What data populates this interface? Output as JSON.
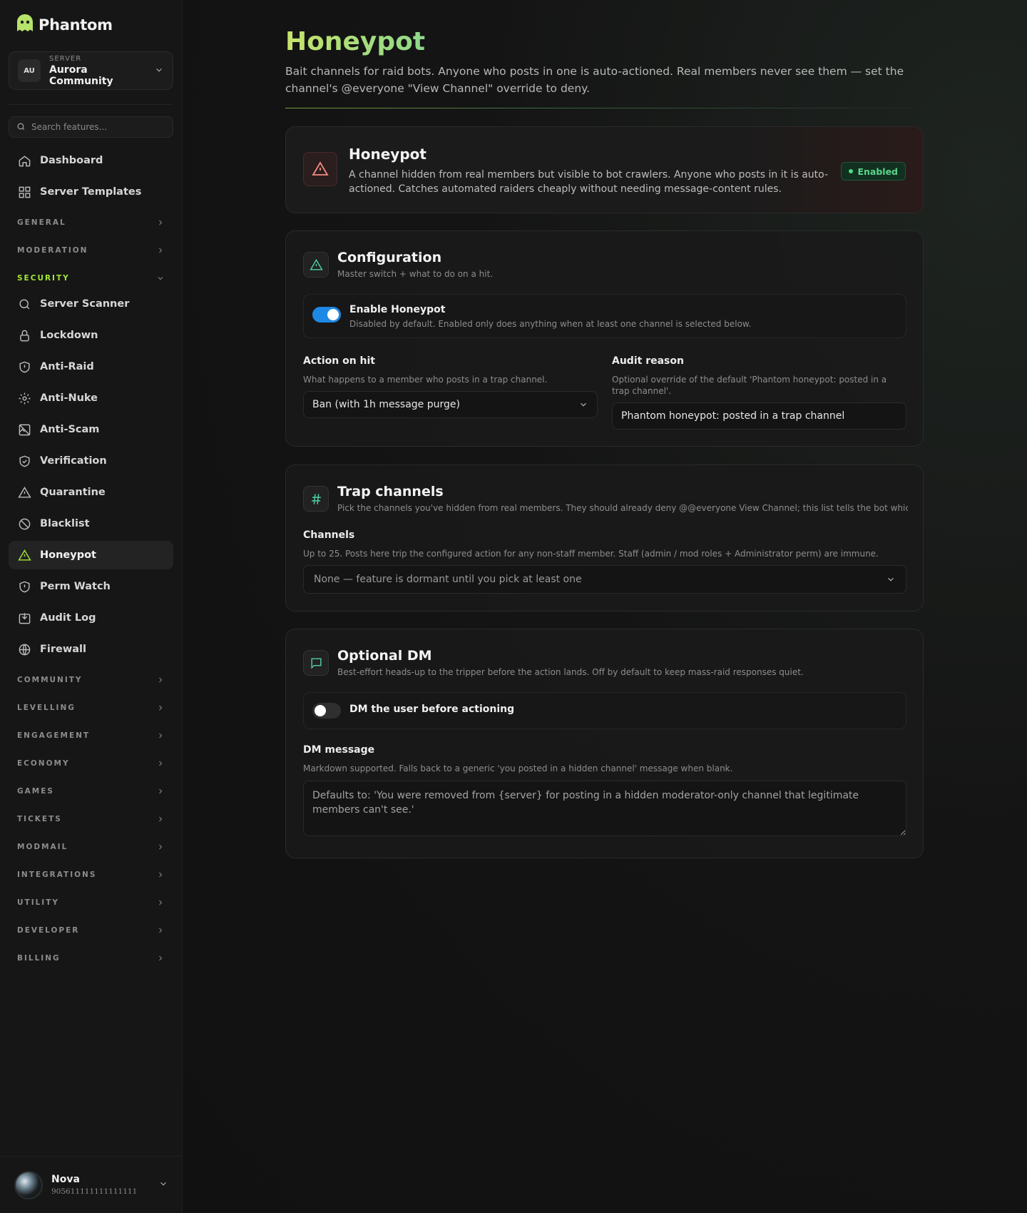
{
  "brand": {
    "name": "Phantom"
  },
  "server": {
    "caption": "SERVER",
    "name": "Aurora Community",
    "initials": "AU"
  },
  "search": {
    "placeholder": "Search features..."
  },
  "nav_top": [
    {
      "label": "Dashboard",
      "icon": "home-icon"
    },
    {
      "label": "Server Templates",
      "icon": "grid-icon"
    }
  ],
  "sections": {
    "general": "GENERAL",
    "moderation": "MODERATION",
    "security": "SECURITY",
    "community": "COMMUNITY",
    "levelling": "LEVELLING",
    "engagement": "ENGAGEMENT",
    "economy": "ECONOMY",
    "games": "GAMES",
    "tickets": "TICKETS",
    "modmail": "MODMAIL",
    "integrations": "INTEGRATIONS",
    "utility": "UTILITY",
    "developer": "DEVELOPER",
    "billing": "BILLING"
  },
  "security_items": [
    {
      "label": "Server Scanner",
      "icon": "search-icon"
    },
    {
      "label": "Lockdown",
      "icon": "lock-icon"
    },
    {
      "label": "Anti-Raid",
      "icon": "shield-alert-icon"
    },
    {
      "label": "Anti-Nuke",
      "icon": "gear-icon"
    },
    {
      "label": "Anti-Scam",
      "icon": "image-off-icon"
    },
    {
      "label": "Verification",
      "icon": "shield-check-icon"
    },
    {
      "label": "Quarantine",
      "icon": "warning-icon"
    },
    {
      "label": "Blacklist",
      "icon": "ban-icon"
    },
    {
      "label": "Honeypot",
      "icon": "warning-icon",
      "active": true
    },
    {
      "label": "Perm Watch",
      "icon": "shield-alert-icon"
    },
    {
      "label": "Audit Log",
      "icon": "inbox-download-icon"
    },
    {
      "label": "Firewall",
      "icon": "globe-icon"
    }
  ],
  "user": {
    "name": "Nova",
    "id": "905611111111111111"
  },
  "page": {
    "title": "Honeypot",
    "subtitle": "Bait channels for raid bots. Anyone who posts in one is auto-actioned. Real members never see them — set the channel's @everyone \"View Channel\" override to deny."
  },
  "hero": {
    "title": "Honeypot",
    "description": "A channel hidden from real members but visible to bot crawlers. Anyone who posts in it is auto-actioned. Catches automated raiders cheaply without needing message-content rules.",
    "status": "Enabled"
  },
  "config": {
    "title": "Configuration",
    "subtitle": "Master switch + what to do on a hit.",
    "toggle_label": "Enable Honeypot",
    "toggle_help": "Disabled by default. Enabled only does anything when at least one channel is selected below.",
    "enabled": true,
    "action_label": "Action on hit",
    "action_help": "What happens to a member who posts in a trap channel.",
    "action_value": "Ban (with 1h message purge)",
    "reason_label": "Audit reason",
    "reason_help": "Optional override of the default 'Phantom honeypot: posted in a trap channel'.",
    "reason_value": "Phantom honeypot: posted in a trap channel"
  },
  "trap": {
    "title": "Trap channels",
    "subtitle": "Pick the channels you've hidden from real members. They should already deny @@everyone View Channel; this list tells the bot which ch...",
    "channels_label": "Channels",
    "channels_help": "Up to 25. Posts here trip the configured action for any non-staff member. Staff (admin / mod roles + Administrator perm) are immune.",
    "channels_value": "None — feature is dormant until you pick at least one"
  },
  "dm": {
    "title": "Optional DM",
    "subtitle": "Best-effort heads-up to the tripper before the action lands. Off by default to keep mass-raid responses quiet.",
    "toggle_label": "DM the user before actioning",
    "enabled": false,
    "message_label": "DM message",
    "message_help": "Markdown supported. Falls back to a generic 'you posted in a hidden channel' message when blank.",
    "message_placeholder": "Defaults to: 'You were removed from {server} for posting in a hidden moderator-only channel that legitimate members can't see.'"
  },
  "colors": {
    "accent": "#a3e635",
    "toggle_on": "#1e88e5",
    "enabled_badge": "#58d68d",
    "danger_icon": "#f28b82",
    "teal_icon": "#4fd1a5"
  }
}
